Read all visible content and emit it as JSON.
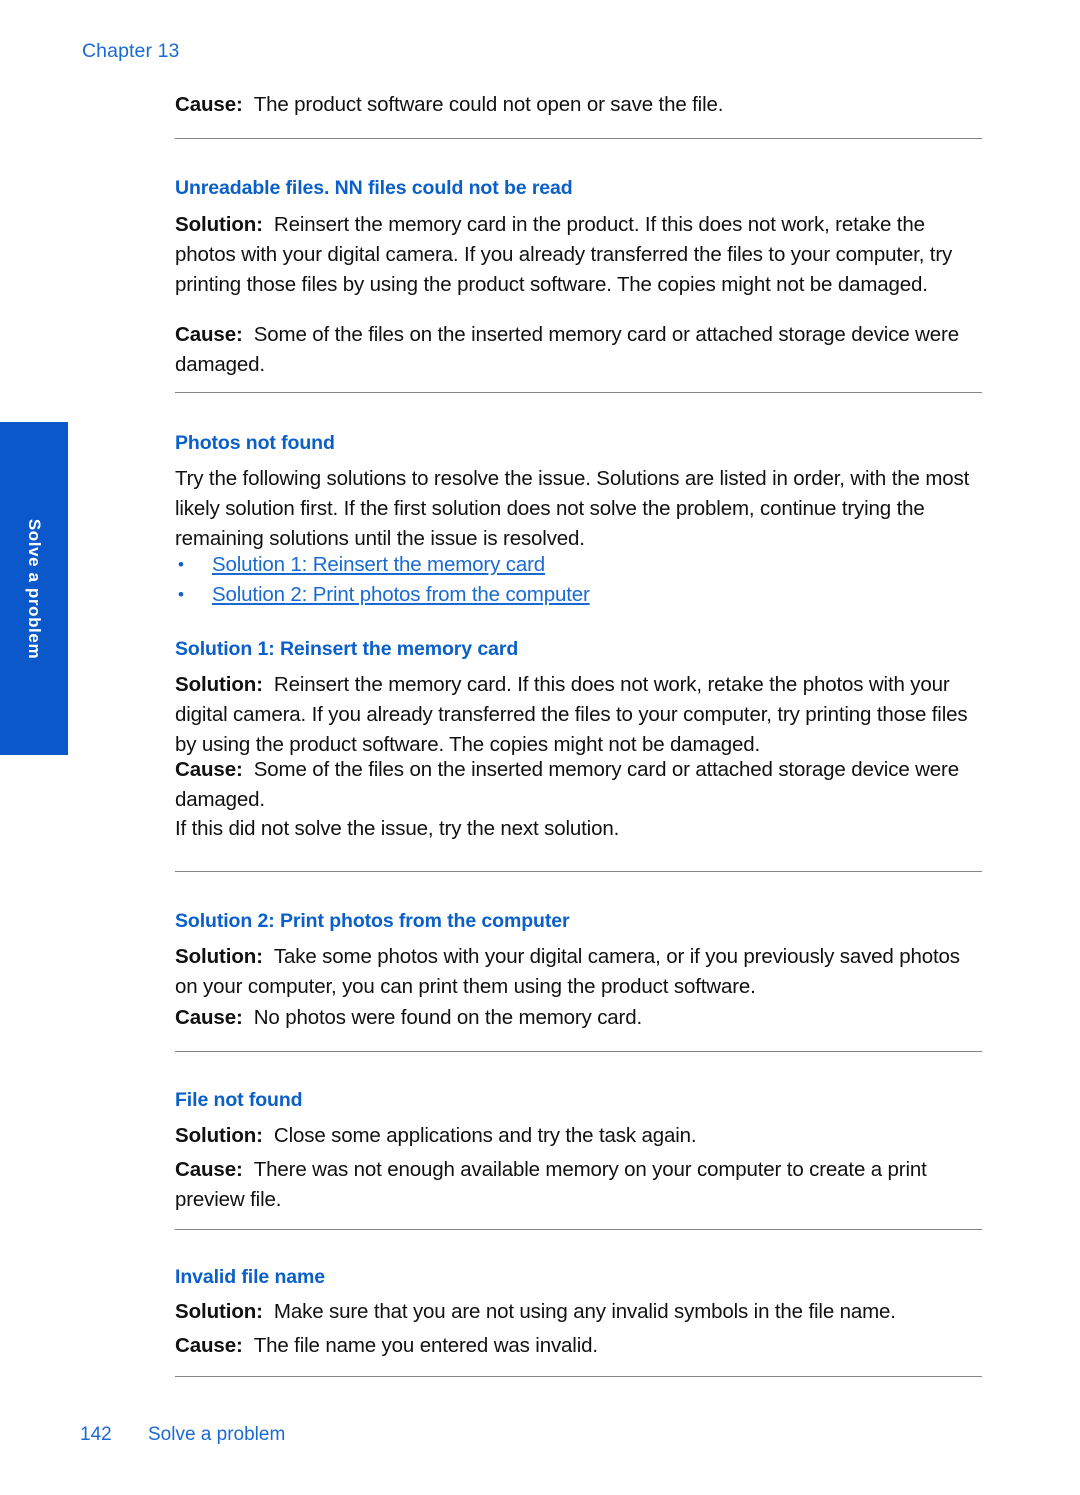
{
  "document": {
    "chapter_label": "Chapter 13",
    "side_tab_label": "Solve a problem",
    "footer_page_number": "142",
    "footer_section_title": "Solve a problem",
    "accent_blue": "#0a5fc8",
    "link_blue": "#1a6ad4",
    "tab_blue": "#0a58ca",
    "rule_gray": "#808387"
  },
  "labels": {
    "cause": "Cause:",
    "solution": "Solution:"
  },
  "blocks": {
    "top_cause": {
      "label": "Cause:",
      "text": "The product software could not open or save the file."
    },
    "unreadable_files": {
      "heading": "Unreadable files. NN files could not be read",
      "solution_label": "Solution:",
      "solution_text": "Reinsert the memory card in the product. If this does not work, retake the photos with your digital camera. If you already transferred the files to your computer, try printing those files by using the product software. The copies might not be damaged.",
      "cause_label": "Cause:",
      "cause_text": "Some of the files on the inserted memory card or attached storage device were damaged."
    },
    "photos_not_found": {
      "heading": "Photos not found",
      "intro": "Try the following solutions to resolve the issue. Solutions are listed in order, with the most likely solution first. If the first solution does not solve the problem, continue trying the remaining solutions until the issue is resolved.",
      "links": [
        "Solution 1: Reinsert the memory card",
        "Solution 2: Print photos from the computer"
      ],
      "bullet_glyph": "•"
    },
    "solution_1": {
      "heading": "Solution 1: Reinsert the memory card",
      "solution_label": "Solution:",
      "solution_text": "Reinsert the memory card. If this does not work, retake the photos with your digital camera. If you already transferred the files to your computer, try printing those files by using the product software. The copies might not be damaged.",
      "cause_label": "Cause:",
      "cause_text": "Some of the files on the inserted memory card or attached storage device were damaged.",
      "followup": "If this did not solve the issue, try the next solution."
    },
    "solution_2": {
      "heading": "Solution 2: Print photos from the computer",
      "solution_label": "Solution:",
      "solution_text": "Take some photos with your digital camera, or if you previously saved photos on your computer, you can print them using the product software.",
      "cause_label": "Cause:",
      "cause_text": "No photos were found on the memory card."
    },
    "file_not_found": {
      "heading": "File not found",
      "solution_label": "Solution:",
      "solution_text": "Close some applications and try the task again.",
      "cause_label": "Cause:",
      "cause_text": "There was not enough available memory on your computer to create a print preview file."
    },
    "invalid_file_name": {
      "heading": "Invalid file name",
      "solution_label": "Solution:",
      "solution_text": "Make sure that you are not using any invalid symbols in the file name.",
      "cause_label": "Cause:",
      "cause_text": "The file name you entered was invalid."
    }
  }
}
